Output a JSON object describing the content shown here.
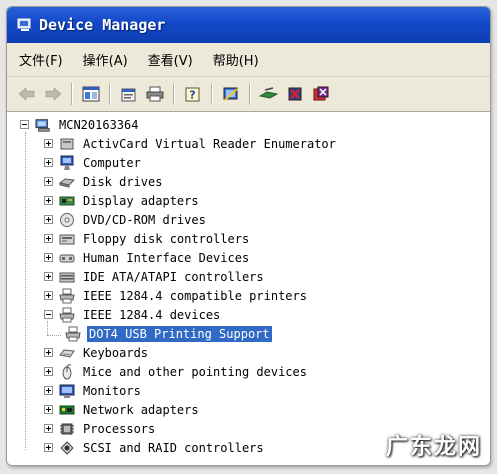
{
  "window": {
    "title": "Device Manager",
    "title_bar_color": "#1247c7"
  },
  "menubar": {
    "items": [
      "文件(F)",
      "操作(A)",
      "查看(V)",
      "帮助(H)"
    ]
  },
  "toolbar": {
    "icons": [
      "back-arrow-icon",
      "forward-arrow-icon",
      "view-tree-icon",
      "properties-icon",
      "print-icon",
      "help-icon",
      "scan-hardware-icon",
      "update-driver-icon",
      "disable-device-icon",
      "uninstall-device-icon"
    ]
  },
  "tree": {
    "root": "MCN20163364",
    "items": [
      {
        "label": "ActivCard Virtual Reader Enumerator",
        "icon": "generic-device-icon"
      },
      {
        "label": "Computer",
        "icon": "computer-icon"
      },
      {
        "label": "Disk drives",
        "icon": "disk-drive-icon"
      },
      {
        "label": "Display adapters",
        "icon": "display-adapter-icon"
      },
      {
        "label": "DVD/CD-ROM drives",
        "icon": "cdrom-icon"
      },
      {
        "label": "Floppy disk controllers",
        "icon": "floppy-controller-icon"
      },
      {
        "label": "Human Interface Devices",
        "icon": "hid-icon"
      },
      {
        "label": "IDE ATA/ATAPI controllers",
        "icon": "ide-controller-icon"
      },
      {
        "label": "IEEE 1284.4 compatible printers",
        "icon": "printer-icon"
      },
      {
        "label": "IEEE 1284.4 devices",
        "icon": "printer-icon",
        "expanded": true
      },
      {
        "label": "DOT4 USB Printing Support",
        "icon": "printer-icon",
        "child": true,
        "selected": true
      },
      {
        "label": "Keyboards",
        "icon": "keyboard-icon"
      },
      {
        "label": "Mice and other pointing devices",
        "icon": "mouse-icon"
      },
      {
        "label": "Monitors",
        "icon": "monitor-icon"
      },
      {
        "label": "Network adapters",
        "icon": "network-adapter-icon"
      },
      {
        "label": "Processors",
        "icon": "processor-icon"
      },
      {
        "label": "SCSI and RAID controllers",
        "icon": "scsi-controller-icon"
      }
    ]
  },
  "watermark": "广东龙网",
  "selection_color": "#316ac5"
}
